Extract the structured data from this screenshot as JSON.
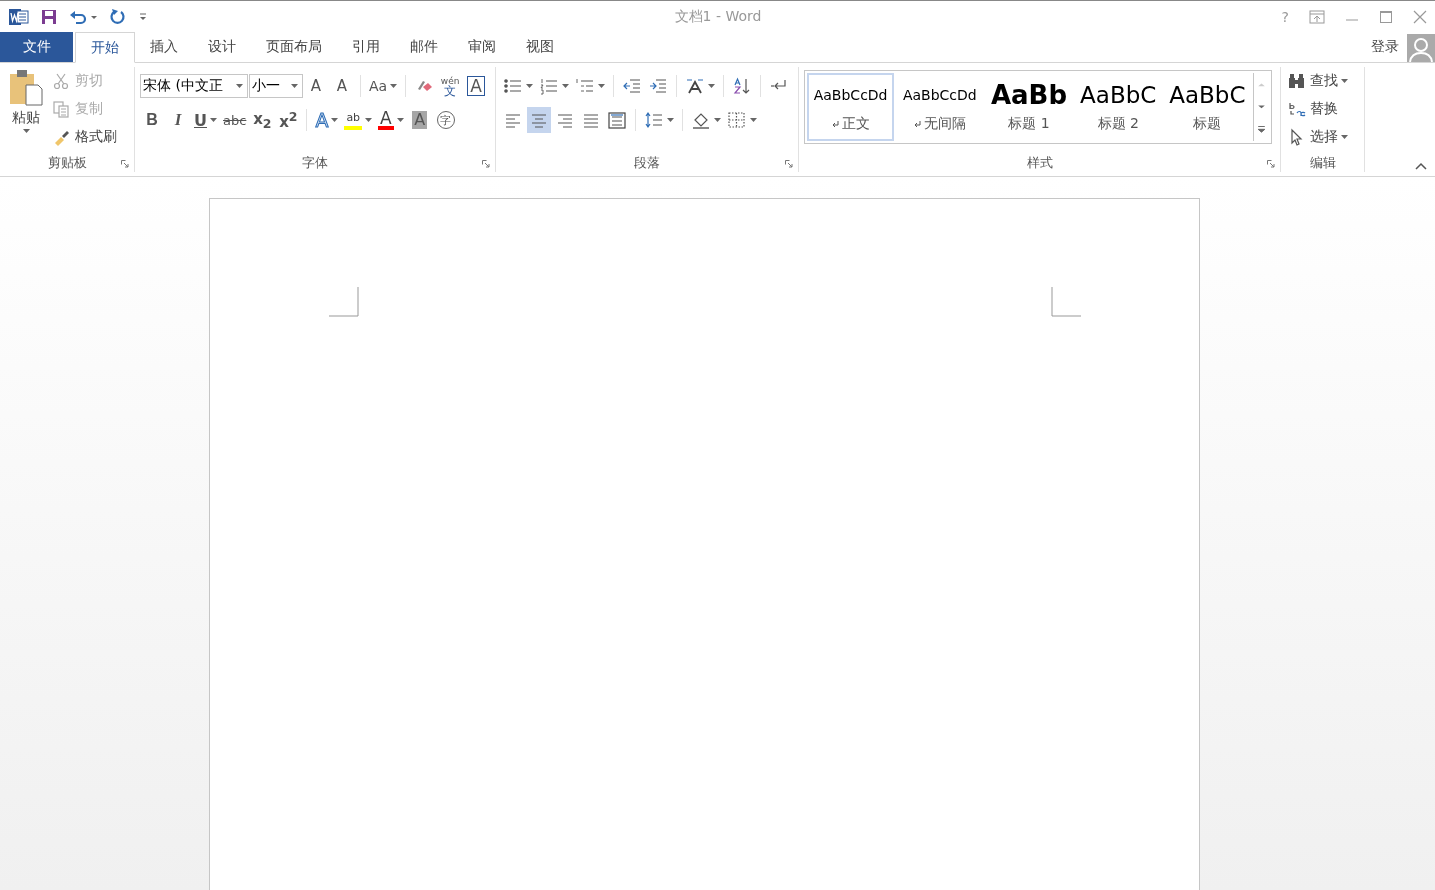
{
  "window": {
    "title": "文档1 - Word",
    "help": "?"
  },
  "tabs": [
    {
      "label": "文件",
      "kind": "file",
      "selected": false
    },
    {
      "label": "开始",
      "kind": "tab",
      "selected": true
    },
    {
      "label": "插入",
      "kind": "tab",
      "selected": false
    },
    {
      "label": "设计",
      "kind": "tab",
      "selected": false
    },
    {
      "label": "页面布局",
      "kind": "tab",
      "selected": false
    },
    {
      "label": "引用",
      "kind": "tab",
      "selected": false
    },
    {
      "label": "邮件",
      "kind": "tab",
      "selected": false
    },
    {
      "label": "审阅",
      "kind": "tab",
      "selected": false
    },
    {
      "label": "视图",
      "kind": "tab",
      "selected": false
    }
  ],
  "account": {
    "sign_in": "登录"
  },
  "clipboard": {
    "title": "剪贴板",
    "paste": "粘贴",
    "items": [
      {
        "kind": "cut",
        "label": "剪切",
        "disabled": true
      },
      {
        "kind": "copy",
        "label": "复制",
        "disabled": true
      },
      {
        "kind": "painter",
        "label": "格式刷",
        "disabled": false
      }
    ]
  },
  "font": {
    "title": "字体",
    "font_name": "宋体 (中文正",
    "font_size": "小一",
    "row1": [
      {
        "kind": "grow",
        "label": "A"
      },
      {
        "kind": "shrink",
        "label": "A"
      },
      {
        "kind": "separator"
      },
      {
        "kind": "case",
        "label": "Aa",
        "dropdown": true
      },
      {
        "kind": "separator"
      },
      {
        "kind": "clear"
      },
      {
        "kind": "phonetic",
        "top": "wén",
        "label": "文"
      },
      {
        "kind": "border",
        "label": "A"
      }
    ],
    "row2": [
      {
        "kind": "bold",
        "label": "B"
      },
      {
        "kind": "italic",
        "label": "I"
      },
      {
        "kind": "underline",
        "label": "U",
        "dropdown": true
      },
      {
        "kind": "strike",
        "label": "abc"
      },
      {
        "kind": "sub",
        "label": "x$_{2}$"
      },
      {
        "kind": "sup",
        "label": "x$^{2}$"
      },
      {
        "kind": "separator"
      },
      {
        "kind": "effects",
        "label": "A",
        "dropdown": true
      },
      {
        "kind": "highlight",
        "label": "ab",
        "color": "#ffff00",
        "dropdown": true
      },
      {
        "kind": "color",
        "label": "A",
        "color": "#ff0000",
        "dropdown": true
      },
      {
        "kind": "shading",
        "label": "A"
      },
      {
        "kind": "enclosed",
        "label": "字"
      }
    ]
  },
  "paragraph": {
    "title": "段落",
    "row1": [
      {
        "kind": "bullets",
        "dropdown": true
      },
      {
        "kind": "numbering",
        "dropdown": true
      },
      {
        "kind": "multilevel",
        "dropdown": true
      },
      {
        "kind": "separator"
      },
      {
        "kind": "outdent"
      },
      {
        "kind": "indent"
      },
      {
        "kind": "separator"
      },
      {
        "kind": "layout",
        "dropdown": true
      },
      {
        "kind": "separator"
      },
      {
        "kind": "sort"
      },
      {
        "kind": "separator"
      },
      {
        "kind": "marks"
      }
    ],
    "row2": [
      {
        "kind": "align-left",
        "selected": false
      },
      {
        "kind": "align-center",
        "selected": true
      },
      {
        "kind": "align-right",
        "selected": false
      },
      {
        "kind": "justify",
        "selected": false
      },
      {
        "kind": "distribute",
        "selected": false
      },
      {
        "kind": "separator"
      },
      {
        "kind": "spacing",
        "dropdown": true
      },
      {
        "kind": "separator"
      },
      {
        "kind": "fill",
        "dropdown": true
      },
      {
        "kind": "borders",
        "dropdown": true
      }
    ]
  },
  "styles": {
    "title": "样式",
    "items": [
      {
        "kind": "normal",
        "preview": "AaBbCcDd",
        "name": "正文",
        "paragraph_mark": true,
        "selected": true
      },
      {
        "kind": "normal",
        "preview": "AaBbCcDd",
        "name": "无间隔",
        "paragraph_mark": true,
        "selected": false
      },
      {
        "kind": "heading1",
        "preview": "AaBb",
        "name": "标题 1",
        "paragraph_mark": false,
        "selected": false
      },
      {
        "kind": "heading2",
        "preview": "AaBbC",
        "name": "标题 2",
        "paragraph_mark": false,
        "selected": false
      },
      {
        "kind": "title",
        "preview": "AaBbC",
        "name": "标题",
        "paragraph_mark": false,
        "selected": false
      }
    ]
  },
  "editing": {
    "title": "编辑",
    "items": [
      {
        "kind": "find",
        "label": "查找",
        "dropdown": true
      },
      {
        "kind": "replace",
        "label": "替换",
        "dropdown": false
      },
      {
        "kind": "select",
        "label": "选择",
        "dropdown": true
      }
    ]
  }
}
